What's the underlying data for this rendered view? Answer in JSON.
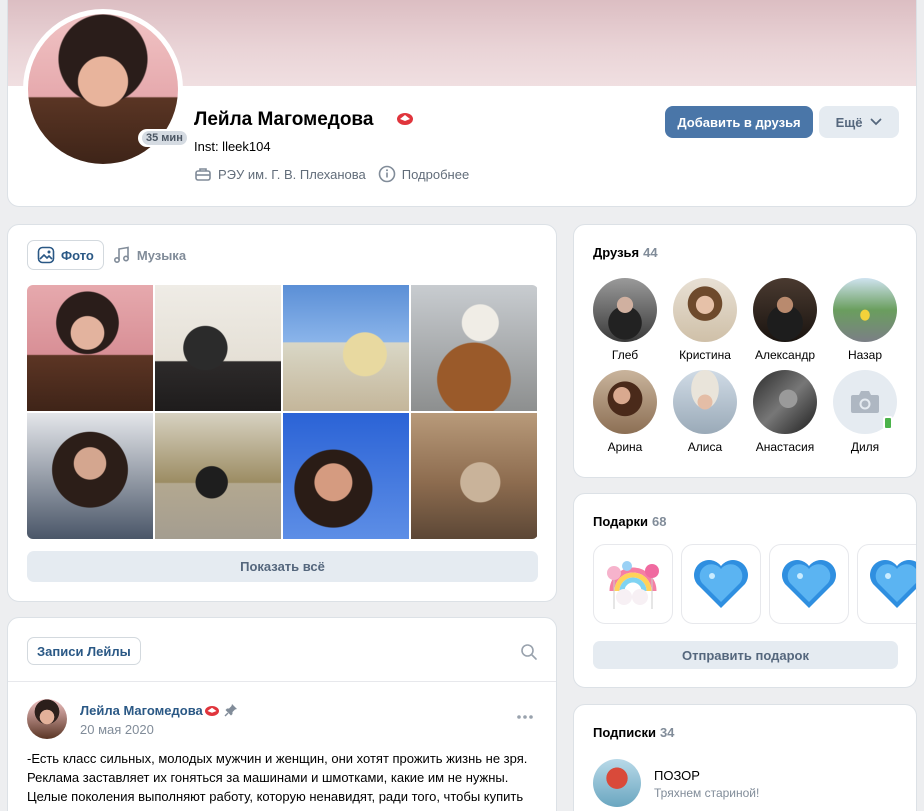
{
  "profile": {
    "name": "Лейла Магомедова",
    "status": "Inst: lleek104",
    "online": "35 мин",
    "university": "РЭУ им. Г. В. Плеханова",
    "details_label": "Подробнее",
    "add_friend_label": "Добавить в друзья",
    "more_label": "Ещё"
  },
  "photos": {
    "tabs": [
      {
        "label": "Фото",
        "icon": "image-icon",
        "active": true
      },
      {
        "label": "Музыка",
        "icon": "music-icon",
        "active": false
      }
    ],
    "show_all_label": "Показать всё"
  },
  "wall": {
    "tab_label": "Записи Лейлы",
    "post": {
      "author": "Лейла Магомедова",
      "date": "20 мая 2020",
      "text": "-Есть класс сильных, молодых мужчин и женщин, они хотят прожить жизнь не зря. Реклама заставляет их гоняться за машинами и шмотками, какие им не нужны. Целые поколения выполняют работу, которую ненавидят, ради того, чтобы купить то, что им не нужно."
    }
  },
  "friends": {
    "title": "Друзья",
    "count": "44",
    "items": [
      {
        "name": "Глеб"
      },
      {
        "name": "Кристина"
      },
      {
        "name": "Александр"
      },
      {
        "name": "Назар"
      },
      {
        "name": "Арина"
      },
      {
        "name": "Алиса"
      },
      {
        "name": "Анастасия"
      },
      {
        "name": "Диля"
      }
    ]
  },
  "gifts": {
    "title": "Подарки",
    "count": "68",
    "send_label": "Отправить подарок"
  },
  "subscriptions": {
    "title": "Подписки",
    "count": "34",
    "item": {
      "name": "ПОЗОР",
      "description": "Тряхнем стариной!"
    }
  },
  "colors": {
    "accent": "#4a76a8",
    "link": "#2a5885",
    "secondary_button": "#e5ebf1",
    "page_background": "#edeef0"
  }
}
